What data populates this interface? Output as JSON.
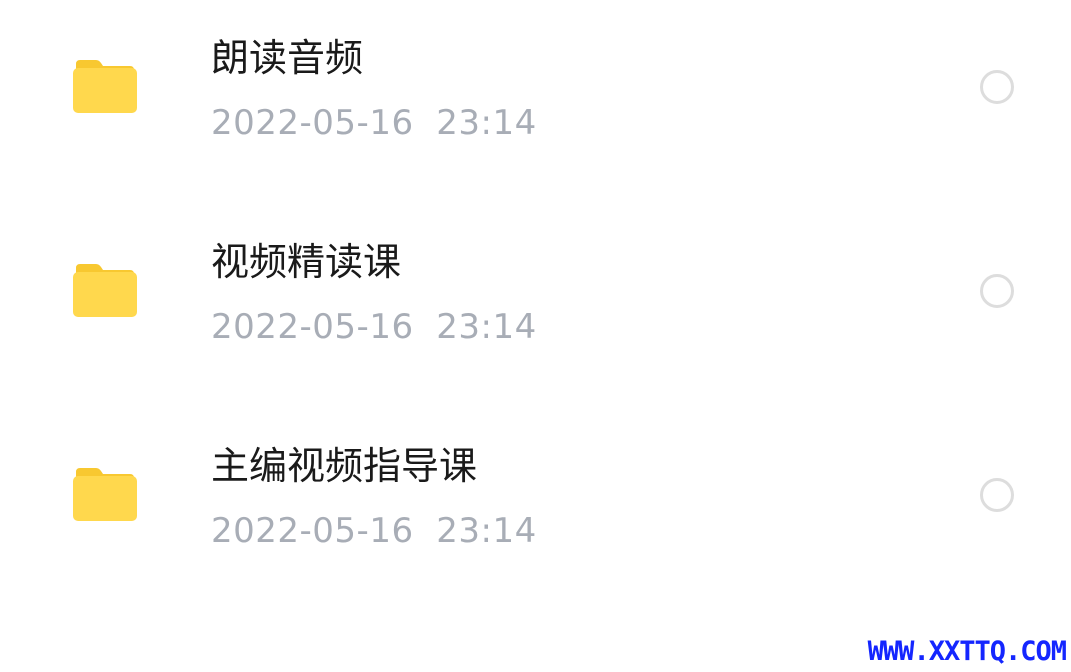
{
  "files": [
    {
      "name": "朗读音频",
      "date": "2022-05-16",
      "time": "23:14",
      "icon": "folder-icon",
      "selected": false
    },
    {
      "name": "视频精读课",
      "date": "2022-05-16",
      "time": "23:14",
      "icon": "folder-icon",
      "selected": false
    },
    {
      "name": "主编视频指导课",
      "date": "2022-05-16",
      "time": "23:14",
      "icon": "folder-icon",
      "selected": false
    }
  ],
  "colors": {
    "folder_front": "#FFD84D",
    "folder_tab": "#F8C830",
    "name_text": "#1A1A1A",
    "meta_text": "#A8ADB6",
    "radio_border": "#DDDDDD",
    "watermark": "#1426FF"
  },
  "watermark": {
    "text": "WWW.XXTTQ.COM"
  }
}
